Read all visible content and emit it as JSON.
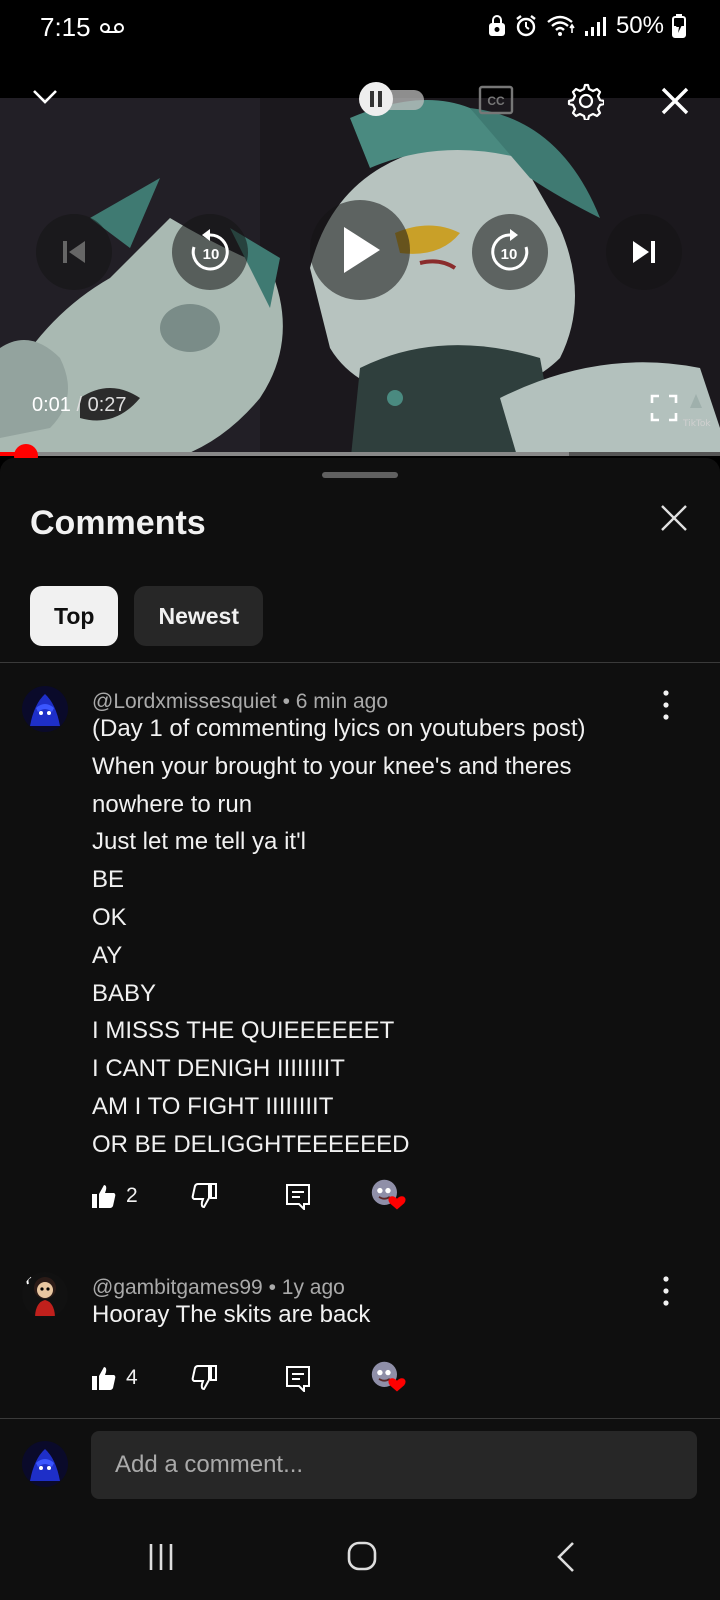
{
  "status_bar": {
    "time": "7:15",
    "battery": "50%"
  },
  "player": {
    "current_time": "0:01",
    "separator": "/",
    "duration": "0:27",
    "progress_fraction": 0.037,
    "buffered_fraction": 0.79,
    "watermark": "TikTok",
    "icons": [
      "chevron-down-icon",
      "autoplay-toggle-icon",
      "cc-icon",
      "settings-icon",
      "close-icon",
      "previous-icon",
      "rewind-10-icon",
      "play-icon",
      "forward-10-icon",
      "next-icon",
      "fullscreen-icon"
    ],
    "cc_label": "CC",
    "skip_seconds": "10"
  },
  "comments_panel": {
    "title": "Comments",
    "chips": [
      {
        "label": "Top",
        "active": true
      },
      {
        "label": "Newest",
        "active": false
      }
    ],
    "comments": [
      {
        "author": "@Lordxmissesquiet",
        "age": "6 min ago",
        "body": "(Day 1 of commenting lyics on youtubers post)\nWhen your brought to your knee's and theres\nnowhere to run\nJust let me tell ya it'l\nBE\nOK\nAY\nBABY\nI MISSS THE QUIEEEEEET\nI CANT DENIGH IIIIIIIIT\nAM I TO FIGHT IIIIIIIIT\nOR BE DELIGGHTEEEEEED",
        "likes": "2"
      },
      {
        "author": "@gambitgames99",
        "age": "1y ago",
        "body": "Hooray The skits are back",
        "likes": "4"
      }
    ],
    "add_comment_placeholder": "Add a comment..."
  },
  "colors": {
    "accent_red": "#ff0000",
    "panel_bg": "#0f0f0f",
    "chip_active_bg": "#f1f1f1",
    "chip_inactive_bg": "#272727",
    "meta_text": "#aaaaaa"
  }
}
